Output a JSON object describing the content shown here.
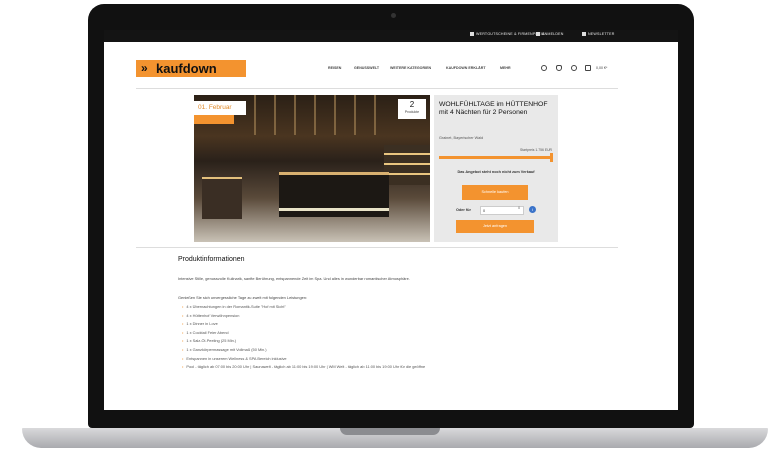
{
  "topbar": {
    "items": [
      {
        "icon": "gift-icon",
        "label": "WERTGUTSCHEINE & FIRMENPREIS"
      },
      {
        "icon": "user-icon",
        "label": "ANMELDEN"
      },
      {
        "icon": "envelope-icon",
        "label": "NEWSLETTER"
      }
    ]
  },
  "header": {
    "logo_text": "kaufdown",
    "nav": [
      "REISEN",
      "GENUSSWELT",
      "WEITERE KATEGORIEN",
      "KAUFDOWN ERKLÄRT",
      "MEHR"
    ],
    "cart_price": "0,00 €*"
  },
  "hero": {
    "date": "01. Februar",
    "time_badge": "",
    "count": "2",
    "count_label": "Produkte"
  },
  "offer": {
    "title": "WOHLFÜHLTAGE im HÜTTENHOF mit 4 Nächten für 2 Personen",
    "location": "Grainet, Bayerischer Wald",
    "price_line": "Startpreis 1.756 EUR",
    "notice": "Das Angebot steht noch nicht zum Verkauf",
    "primary_button": "Schnelle kaufen",
    "qty_label": "Oder für",
    "qty_value": "0",
    "qty_control": "0",
    "secondary_button": "Jetzt anfragen"
  },
  "product_info": {
    "heading": "Produktinformationen",
    "intro": "Intensive Stille, genussvolle Kulinarik, sanfte Berührung, entspannende Zeit im Spa. Und alles in wunderbar romantischer Atmosphäre.",
    "lead": "Genießen Sie sich unvergessliche Tage zu zweit mit folgenden Leistungen:",
    "items": [
      "4 x Übernachtungen in der Romantik-Suite \"Hof mit Sicht\"",
      "4 x Hüttenhof Verwöhnpension",
      "1 x Dinner in Love",
      "1 x Cocktail Feier Abend",
      "1 x Salz-Öl-Peeling (25 Min.)",
      "1 x Ganzkörpermassage mit Vollmaß (50 Min.)",
      "Entspannen in unserem Wellness & SPA Bereich inklusive",
      "Pool - täglich ab 07:00 bis 20:00 Uhr | Saunawelt - täglich ab 11:00 bis 19:00 Uhr | WM Welt - täglich ab 11:00 bis 19:00 Uhr für die geöffne"
    ]
  },
  "colors": {
    "accent": "#f3932f",
    "topbar": "#141414",
    "panel": "#e9e9e9"
  }
}
